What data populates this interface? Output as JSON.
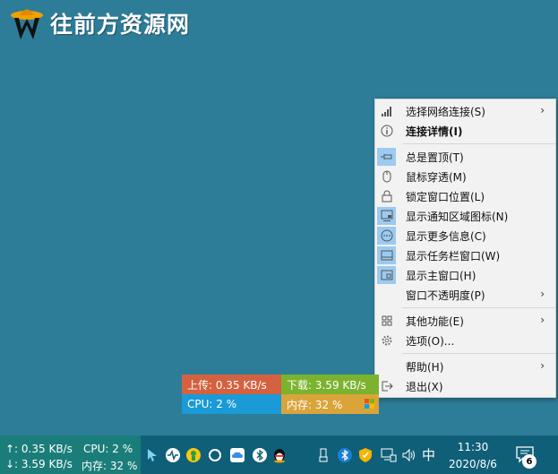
{
  "watermark": {
    "text": "往前方资源网"
  },
  "menu": {
    "items": [
      {
        "label": "选择网络连接(S)",
        "icon": "signal-icon",
        "submenu": true,
        "checked": false,
        "bold": false
      },
      {
        "label": "连接详情(I)",
        "icon": "info-icon",
        "submenu": false,
        "checked": false,
        "bold": true
      },
      {
        "label": "总是置顶(T)",
        "icon": "pin-icon",
        "submenu": false,
        "checked": true,
        "bold": false
      },
      {
        "label": "鼠标穿透(M)",
        "icon": "mouse-icon",
        "submenu": false,
        "checked": false,
        "bold": false
      },
      {
        "label": "锁定窗口位置(L)",
        "icon": "lock-icon",
        "submenu": false,
        "checked": false,
        "bold": false
      },
      {
        "label": "显示通知区域图标(N)",
        "icon": "tray-monitor-icon",
        "submenu": false,
        "checked": true,
        "bold": false
      },
      {
        "label": "显示更多信息(C)",
        "icon": "more-icon",
        "submenu": false,
        "checked": true,
        "bold": false
      },
      {
        "label": "显示任务栏窗口(W)",
        "icon": "taskbar-window-icon",
        "submenu": false,
        "checked": true,
        "bold": false
      },
      {
        "label": "显示主窗口(H)",
        "icon": "main-window-icon",
        "submenu": false,
        "checked": true,
        "bold": false
      },
      {
        "label": "窗口不透明度(P)",
        "icon": "",
        "submenu": true,
        "checked": false,
        "bold": false
      },
      {
        "label": "其他功能(E)",
        "icon": "grid-icon",
        "submenu": true,
        "checked": false,
        "bold": false
      },
      {
        "label": "选项(O)...",
        "icon": "gear-icon",
        "submenu": false,
        "checked": false,
        "bold": false
      },
      {
        "label": "帮助(H)",
        "icon": "",
        "submenu": true,
        "checked": false,
        "bold": false
      },
      {
        "label": "退出(X)",
        "icon": "exit-icon",
        "submenu": false,
        "checked": false,
        "bold": false
      }
    ]
  },
  "widget": {
    "upload": "上传: 0.35 KB/s",
    "download": "下载: 3.59 KB/s",
    "cpu": "CPU: 2 %",
    "memory": "内存: 32 %",
    "colors": {
      "upload": "#d4613f",
      "download": "#7bb32e",
      "cpu": "#1a9ad6",
      "memory": "#d9a43a"
    }
  },
  "taskbar": {
    "up": "↑: 0.35 KB/s",
    "down": "↓: 3.59 KB/s",
    "cpu": "CPU: 2 %",
    "memory": "内存: 32 %",
    "ime": "中",
    "time": "11:30",
    "date": "2020/8/6",
    "notification_count": "6"
  }
}
